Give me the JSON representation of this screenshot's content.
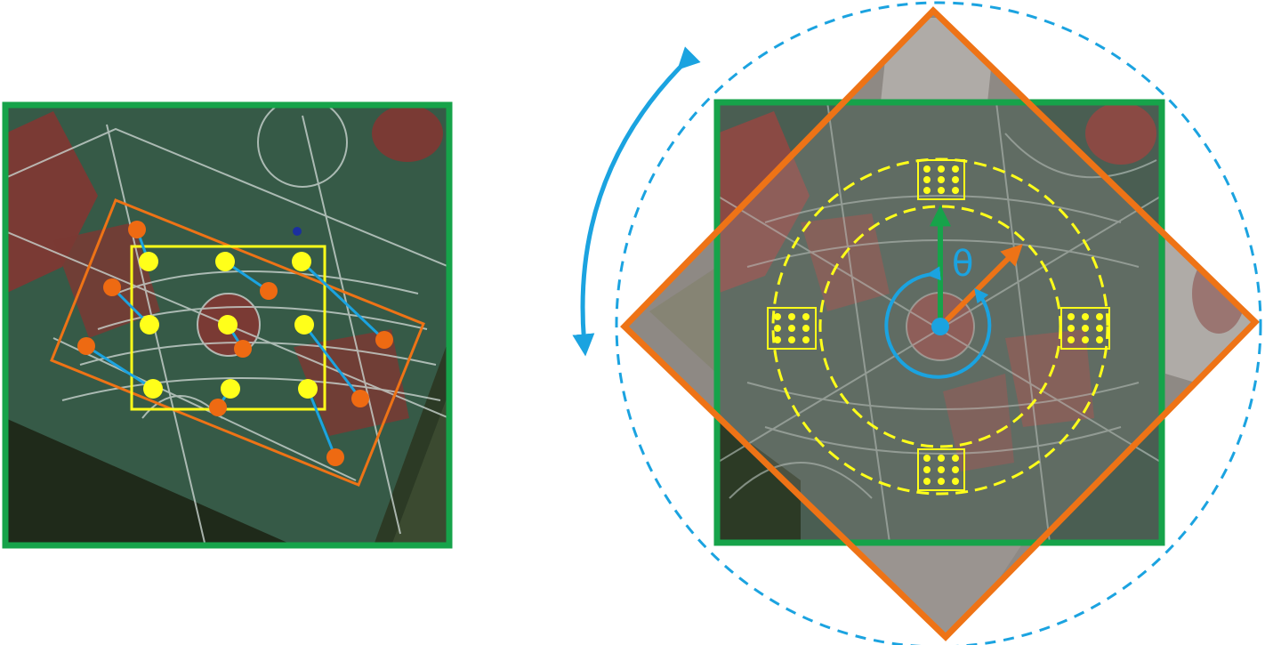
{
  "figure": {
    "theta_label": "θ"
  },
  "colors": {
    "frame_green": "#16a34a",
    "rotated_orange": "#ee7316",
    "keypoint_yellow": "#ffff1a",
    "keypoint_orange": "#ee6a12",
    "match_blue": "#1ba3e0",
    "court_green": "#365a47",
    "court_red": "#7a3a34",
    "court_lines": "#c9d3ce",
    "grass": "#3b4a30",
    "trees": "#1f2a1a",
    "ground": "#8a8580"
  },
  "icons": {
    "rotation_arrow": "curved-double-arrow-icon",
    "sampling_pattern": "3x3-dot-grid-icon"
  }
}
